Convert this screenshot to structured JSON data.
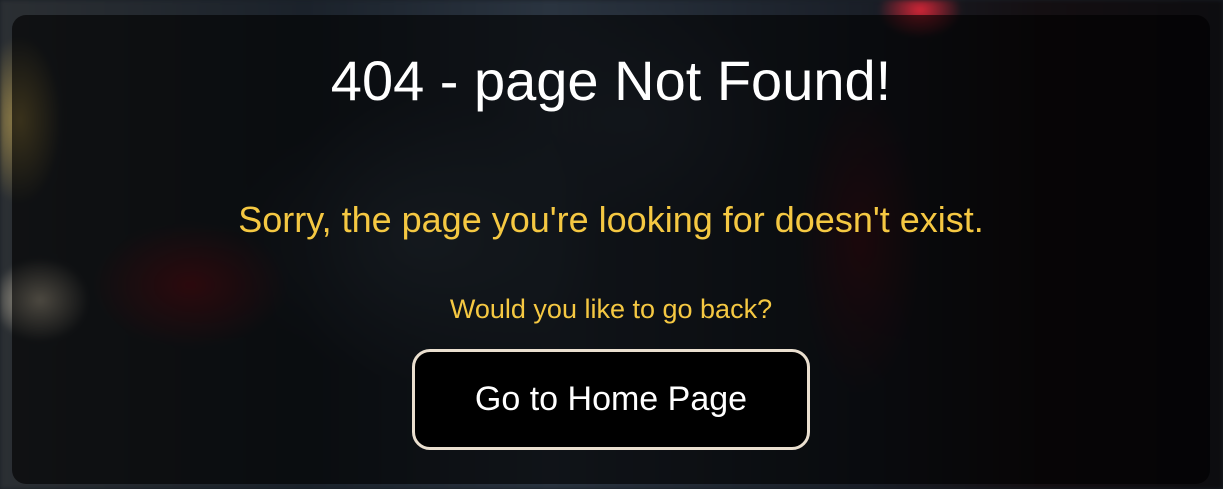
{
  "error_page": {
    "title": "404 - page Not Found!",
    "message": "Sorry, the page you're looking for doesn't exist.",
    "prompt": "Would you like to go back?",
    "home_button_label": "Go to Home Page"
  },
  "colors": {
    "title": "#ffffff",
    "accent_text": "#f5c842",
    "button_background": "#000000",
    "button_border": "#eadfcf",
    "overlay": "rgba(0,0,0,0.62)"
  }
}
